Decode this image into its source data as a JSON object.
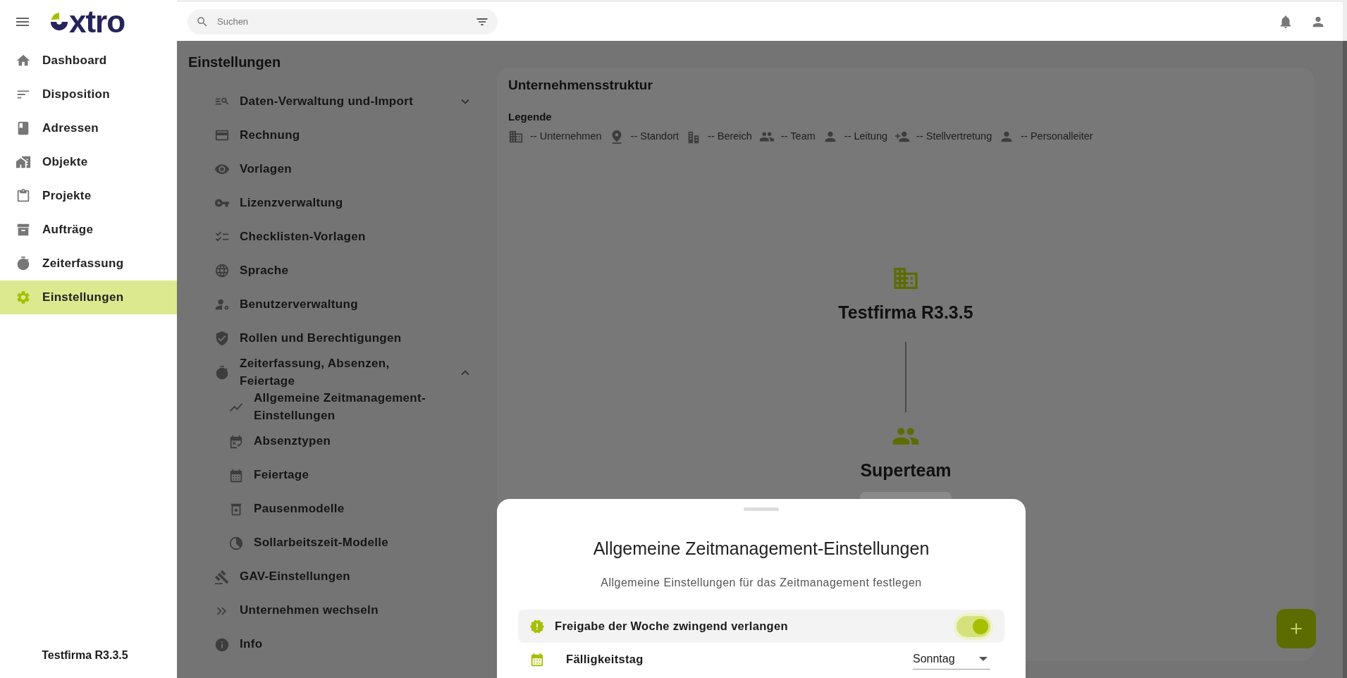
{
  "app": {
    "logo": "xtro"
  },
  "sidebar": {
    "items": [
      {
        "label": "Dashboard",
        "selected": false
      },
      {
        "label": "Disposition",
        "selected": false
      },
      {
        "label": "Adressen",
        "selected": false
      },
      {
        "label": "Objekte",
        "selected": false
      },
      {
        "label": "Projekte",
        "selected": false
      },
      {
        "label": "Aufträge",
        "selected": false
      },
      {
        "label": "Zeiterfassung",
        "selected": false
      },
      {
        "label": "Einstellungen",
        "selected": true
      }
    ],
    "footer": "Testfirma R3.3.5"
  },
  "search": {
    "placeholder": "Suchen"
  },
  "settings_menu": {
    "title": "Einstellungen",
    "items": [
      {
        "label": "Daten-Verwaltung und-Import",
        "expanded": false
      },
      {
        "label": "Rechnung"
      },
      {
        "label": "Vorlagen"
      },
      {
        "label": "Lizenzverwaltung"
      },
      {
        "label": "Checklisten-Vorlagen"
      },
      {
        "label": "Sprache"
      },
      {
        "label": "Benutzerverwaltung"
      },
      {
        "label": "Rollen und Berechtigungen"
      },
      {
        "label": "Zeiterfassung, Absenzen, Feiertage",
        "expanded": true,
        "children": [
          {
            "label": "Allgemeine Zeitmanagement-Einstellungen"
          },
          {
            "label": "Absenztypen"
          },
          {
            "label": "Feiertage"
          },
          {
            "label": "Pausenmodelle"
          },
          {
            "label": "Sollarbeitszeit-Modelle"
          }
        ]
      },
      {
        "label": "GAV-Einstellungen"
      },
      {
        "label": "Unternehmen wechseln"
      },
      {
        "label": "Info"
      }
    ]
  },
  "structure": {
    "title": "Unternehmensstruktur",
    "legend_title": "Legende",
    "legend": [
      {
        "label": "-- Unternehmen"
      },
      {
        "label": "-- Standort"
      },
      {
        "label": "-- Bereich"
      },
      {
        "label": "-- Team"
      },
      {
        "label": "-- Leitung"
      },
      {
        "label": "-- Stellvertretung"
      },
      {
        "label": "-- Personalleiter"
      }
    ],
    "nodes": [
      {
        "name": "Testfirma R3.3.5"
      },
      {
        "name": "Superteam"
      }
    ]
  },
  "sheet": {
    "title": "Allgemeine Zeitmanagement-Einstellungen",
    "subtitle": "Allgemeine Einstellungen für das Zeitmanagement festlegen",
    "rows": [
      {
        "kind": "toggle",
        "label": "Freigabe der Woche zwingend verlangen",
        "on": true
      },
      {
        "kind": "select",
        "label": "Fälligkeitstag",
        "value": "Sonntag"
      }
    ]
  }
}
